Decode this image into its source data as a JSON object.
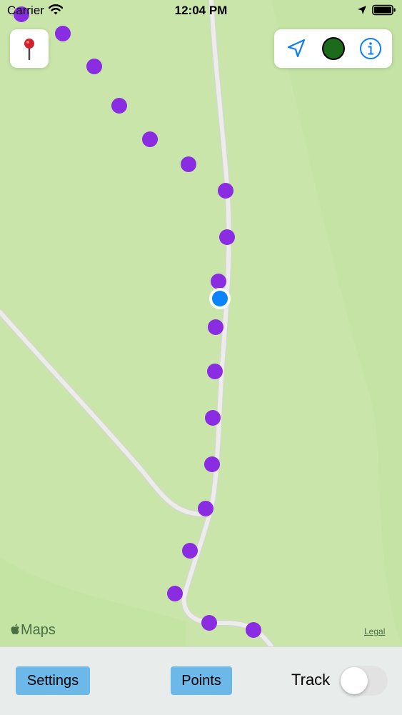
{
  "status_bar": {
    "carrier": "Carrier",
    "time": "12:04 PM"
  },
  "map": {
    "attribution": "Maps",
    "legal_link": "Legal",
    "colors": {
      "terrain": "#c9e5a9",
      "road": "#e6e6e0",
      "track_point": "#8a2ce2",
      "current_location": "#0a84ff"
    },
    "track_point_count": 20
  },
  "controls": {
    "pin_button": "pin-icon",
    "panel": [
      "location-arrow-icon",
      "status-dot-icon",
      "info-icon"
    ],
    "status_dot_color": "#1b6b1b",
    "accent": "#0a7ff5"
  },
  "toolbar": {
    "settings_label": "Settings",
    "points_label": "Points",
    "track_label": "Track",
    "track_on": false
  }
}
